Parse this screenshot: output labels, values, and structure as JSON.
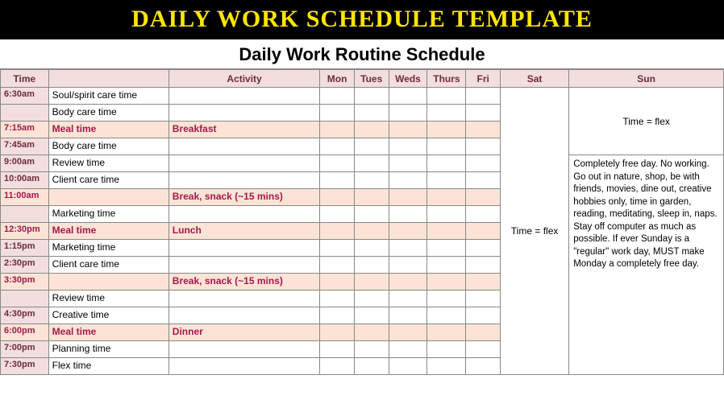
{
  "banner": "DAILY WORK SCHEDULE TEMPLATE",
  "subtitle": "Daily Work Routine Schedule",
  "headers": {
    "time": "Time",
    "entry": "",
    "activity": "Activity",
    "mon": "Mon",
    "tues": "Tues",
    "weds": "Weds",
    "thurs": "Thurs",
    "fri": "Fri",
    "sat": "Sat",
    "sun": "Sun"
  },
  "sat_text": "Time = flex",
  "sun_text_top": "Time = flex",
  "sun_text_body": "Completely free day. No working. Go out in nature, shop, be with friends, movies, dine out, creative hobbies only, time in garden, reading, meditating, sleep in, naps.       Stay off computer as much as possible.      If ever Sunday is a \"regular\" work day, MUST make Monday a completely free day.",
  "rows": [
    {
      "time": "6:30am",
      "entry": "Soul/spirit care time",
      "activity": "",
      "hl": false
    },
    {
      "time": "",
      "entry": "Body care time",
      "activity": "",
      "hl": false
    },
    {
      "time": "7:15am",
      "entry": "Meal time",
      "activity": "Breakfast",
      "hl": true
    },
    {
      "time": "7:45am",
      "entry": "Body care time",
      "activity": "",
      "hl": false
    },
    {
      "time": "9:00am",
      "entry": "Review time",
      "activity": "",
      "hl": false
    },
    {
      "time": "10:00am",
      "entry": "Client care time",
      "activity": "",
      "hl": false
    },
    {
      "time": "11:00am",
      "entry": "",
      "activity": "Break, snack (~15 mins)",
      "hl": true
    },
    {
      "time": "",
      "entry": "Marketing time",
      "activity": "",
      "hl": false
    },
    {
      "time": "12:30pm",
      "entry": "Meal time",
      "activity": "Lunch",
      "hl": true
    },
    {
      "time": "1:15pm",
      "entry": "Marketing time",
      "activity": "",
      "hl": false
    },
    {
      "time": "2:30pm",
      "entry": "Client care time",
      "activity": "",
      "hl": false
    },
    {
      "time": "3:30pm",
      "entry": "",
      "activity": "Break, snack (~15 mins)",
      "hl": true
    },
    {
      "time": "",
      "entry": "Review time",
      "activity": "",
      "hl": false
    },
    {
      "time": "4:30pm",
      "entry": "Creative time",
      "activity": "",
      "hl": false
    },
    {
      "time": "6:00pm",
      "entry": "Meal time",
      "activity": "Dinner",
      "hl": true
    },
    {
      "time": "7:00pm",
      "entry": "Planning time",
      "activity": "",
      "hl": false
    },
    {
      "time": "7:30pm",
      "entry": "Flex time",
      "activity": "",
      "hl": false
    }
  ]
}
